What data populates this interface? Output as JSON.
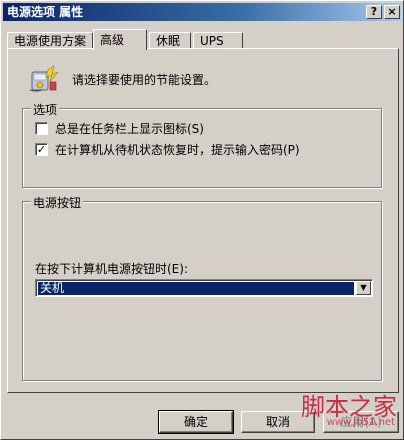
{
  "window": {
    "title": "电源选项 属性",
    "help_label": "?",
    "close_label": "×"
  },
  "tabs": [
    {
      "label": "电源使用方案",
      "active": false
    },
    {
      "label": "高级",
      "active": true
    },
    {
      "label": "休眠",
      "active": false
    },
    {
      "label": "UPS",
      "active": false
    }
  ],
  "intro": {
    "icon": "power-options-icon",
    "text": "请选择要使用的节能设置。"
  },
  "options_group": {
    "legend": "选项",
    "items": [
      {
        "label": "总是在任务栏上显示图标(S)",
        "checked": false
      },
      {
        "label": "在计算机从待机状态恢复时，提示输入密码(P)",
        "checked": true
      }
    ]
  },
  "power_buttons_group": {
    "legend": "电源按钮",
    "dropdown_label": "在按下计算机电源按钮时(E):",
    "dropdown_value": "关机"
  },
  "buttons": {
    "ok": "确定",
    "cancel": "取消",
    "apply": "应用(A)"
  },
  "watermark": {
    "text": "脚本之家",
    "url": "www.jb51.net"
  },
  "colors": {
    "titlebar_start": "#0a246a",
    "titlebar_end": "#a6caf0",
    "face": "#d4d0c8",
    "selection": "#0a246a"
  }
}
